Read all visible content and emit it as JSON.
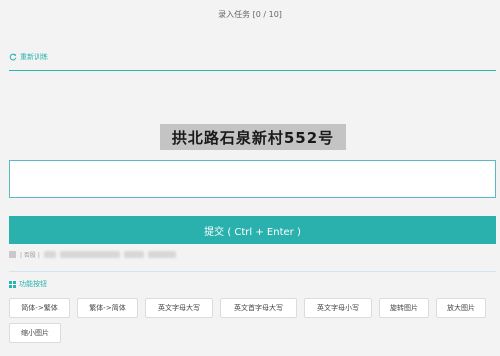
{
  "header": {
    "title": "录入任务 [0 / 10]"
  },
  "retrain": {
    "label": "重新训练",
    "icon": "refresh-icon"
  },
  "task": {
    "address_image_text": "拱北路石泉新村552号"
  },
  "answer": {
    "value": "",
    "placeholder": ""
  },
  "submit": {
    "label": "提交 ( Ctrl + Enter )"
  },
  "info": {
    "text1": "| 否股 |"
  },
  "functions": {
    "title": "功能按钮",
    "buttons": [
      {
        "label": "简体->繁体"
      },
      {
        "label": "繁体->简体"
      },
      {
        "label": "英文字母大写"
      },
      {
        "label": "英文首字母大写"
      },
      {
        "label": "英文字母小写"
      },
      {
        "label": "旋转图片"
      },
      {
        "label": "放大图片"
      },
      {
        "label": "缩小图片"
      }
    ]
  },
  "colors": {
    "accent": "#2ab0ad",
    "background": "#f3f3f3"
  }
}
